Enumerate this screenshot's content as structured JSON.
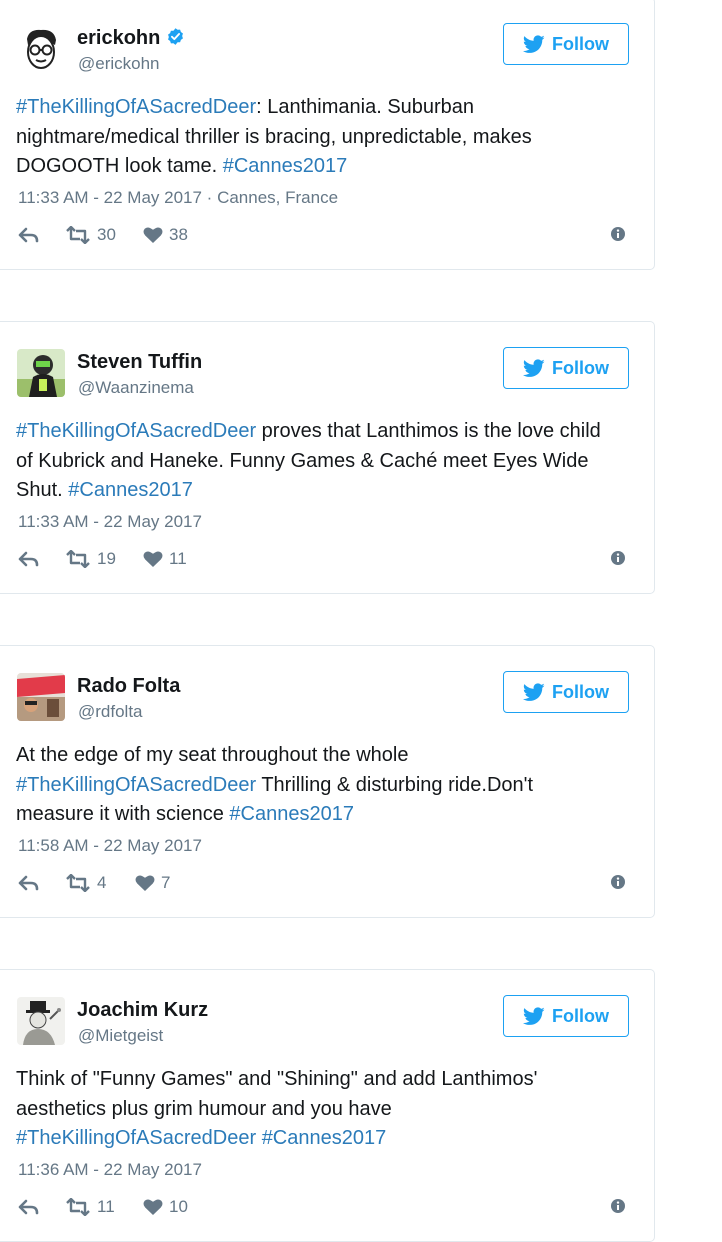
{
  "colors": {
    "link": "#2b7bb9",
    "accent": "#1da1f2",
    "meta": "#657786"
  },
  "follow_label": "Follow",
  "tweets": [
    {
      "name": "erickohn",
      "verified": true,
      "handle": "@erickohn",
      "text_parts": [
        {
          "t": "#TheKillingOfASacredDeer",
          "hash": true
        },
        {
          "t": ": Lanthimania. Suburban nightmare/medical thriller is bracing, unpredictable, makes DOGOOTH look tame. ",
          "hash": false
        },
        {
          "t": "#Cannes2017",
          "hash": true
        }
      ],
      "meta": "11:33 AM - 22 May 2017 · Cannes, France",
      "retweets": "30",
      "likes": "38"
    },
    {
      "name": "Steven Tuffin",
      "verified": false,
      "handle": "@Waanzinema",
      "text_parts": [
        {
          "t": "#TheKillingOfASacredDeer",
          "hash": true
        },
        {
          "t": " proves that Lanthimos is the love child of Kubrick and Haneke. Funny Games & Caché meet Eyes Wide Shut. ",
          "hash": false
        },
        {
          "t": "#Cannes2017",
          "hash": true
        }
      ],
      "meta": "11:33 AM - 22 May 2017",
      "retweets": "19",
      "likes": "11"
    },
    {
      "name": "Rado Folta",
      "verified": false,
      "handle": "@rdfolta",
      "text_parts": [
        {
          "t": "At the edge of my seat throughout the whole ",
          "hash": false
        },
        {
          "t": "#TheKillingOfASacredDeer",
          "hash": true
        },
        {
          "t": " Thrilling & disturbing ride.Don't measure it with science ",
          "hash": false
        },
        {
          "t": "#Cannes2017",
          "hash": true
        }
      ],
      "meta": "11:58 AM - 22 May 2017",
      "retweets": "4",
      "likes": "7"
    },
    {
      "name": "Joachim Kurz",
      "verified": false,
      "handle": "@Mietgeist",
      "text_parts": [
        {
          "t": "Think of \"Funny Games\" and \"Shining\" and add Lanthimos' aesthetics plus grim humour and you have ",
          "hash": false
        },
        {
          "t": "#TheKillingOfASacredDeer",
          "hash": true
        },
        {
          "t": " ",
          "hash": false
        },
        {
          "t": "#Cannes2017",
          "hash": true
        }
      ],
      "meta": "11:36 AM - 22 May 2017",
      "retweets": "11",
      "likes": "10"
    }
  ]
}
